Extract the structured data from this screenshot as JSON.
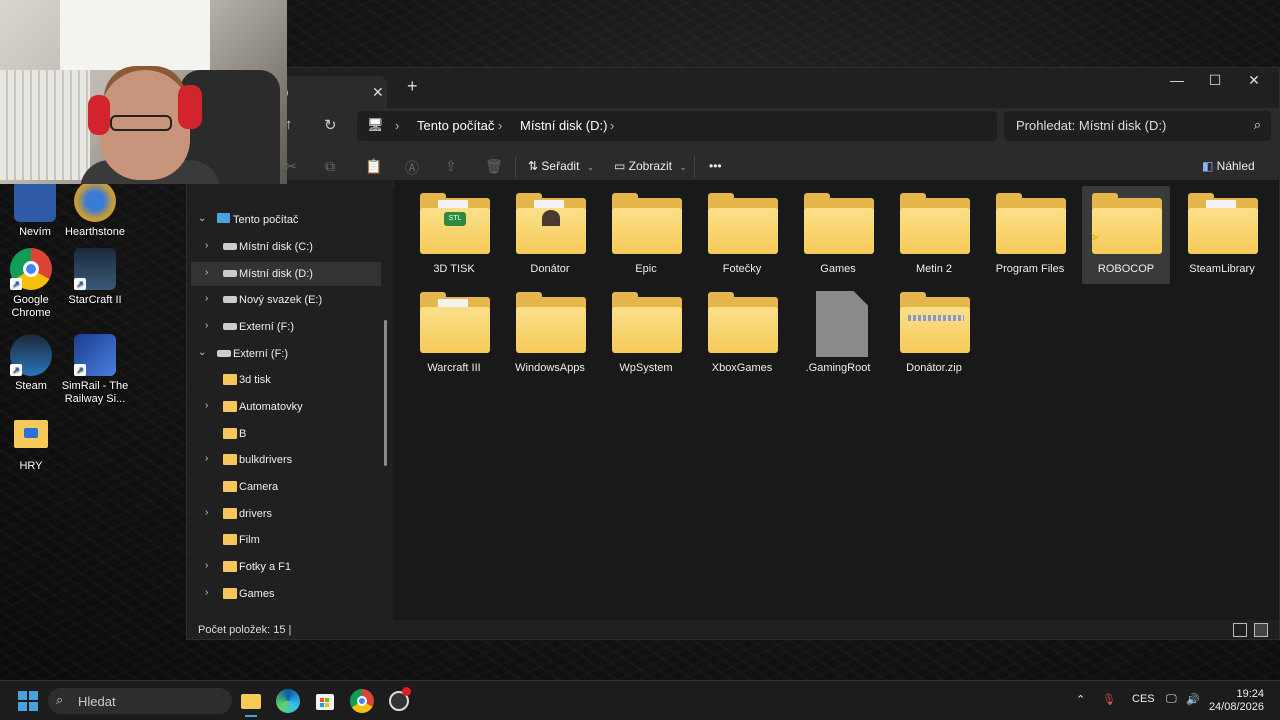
{
  "desktop": {
    "icons": [
      {
        "label": "Nevím"
      },
      {
        "label": "Hearthstone"
      },
      {
        "label": "Google Chrome"
      },
      {
        "label": "StarCraft II"
      },
      {
        "label": "Steam"
      },
      {
        "label": "SimRail - The Railway Si..."
      },
      {
        "label": "HRY"
      }
    ]
  },
  "explorer": {
    "tab_title": ":)",
    "address": {
      "crumbs": [
        "Tento počítač",
        "Místní disk (D:)"
      ]
    },
    "search": {
      "placeholder": "Prohledat: Místní disk (D:)"
    },
    "toolbar": {
      "sort_label": "Seřadit",
      "view_label": "Zobrazit",
      "more_label": "•••",
      "preview_label": "Náhled"
    },
    "nav": [
      {
        "label": "Tento počítač"
      },
      {
        "label": "Místní disk (C:)"
      },
      {
        "label": "Místní disk (D:)"
      },
      {
        "label": "Nový svazek (E:)"
      },
      {
        "label": "Externí (F:)"
      },
      {
        "label": "Externí (F:)"
      },
      {
        "label": "3d tisk"
      },
      {
        "label": "Automatovky"
      },
      {
        "label": "B"
      },
      {
        "label": "bulkdrivers"
      },
      {
        "label": "Camera"
      },
      {
        "label": "drivers"
      },
      {
        "label": "Film"
      },
      {
        "label": "Fotky a F1"
      },
      {
        "label": "Games"
      }
    ],
    "items": [
      {
        "name": "3D TISK",
        "kind": "folder"
      },
      {
        "name": "Donátor",
        "kind": "folder"
      },
      {
        "name": "Epic",
        "kind": "folder"
      },
      {
        "name": "Fotečky",
        "kind": "folder"
      },
      {
        "name": "Games",
        "kind": "folder"
      },
      {
        "name": "Metin 2",
        "kind": "folder"
      },
      {
        "name": "Program Files",
        "kind": "folder"
      },
      {
        "name": "ROBOCOP",
        "kind": "folder"
      },
      {
        "name": "SteamLibrary",
        "kind": "folder"
      },
      {
        "name": "Warcraft III",
        "kind": "folder"
      },
      {
        "name": "WindowsApps",
        "kind": "folder"
      },
      {
        "name": "WpSystem",
        "kind": "folder"
      },
      {
        "name": "XboxGames",
        "kind": "folder"
      },
      {
        "name": ".GamingRoot",
        "kind": "file"
      },
      {
        "name": "Donátor.zip",
        "kind": "zip"
      }
    ],
    "status": "Počet položek: 15  |"
  },
  "taskbar": {
    "search_label": "Hledat",
    "language": "CES",
    "time": "19:24",
    "date": "24/08/2026"
  },
  "colors": {
    "folder": "#f5ca58",
    "accent": "#4aa3df"
  }
}
